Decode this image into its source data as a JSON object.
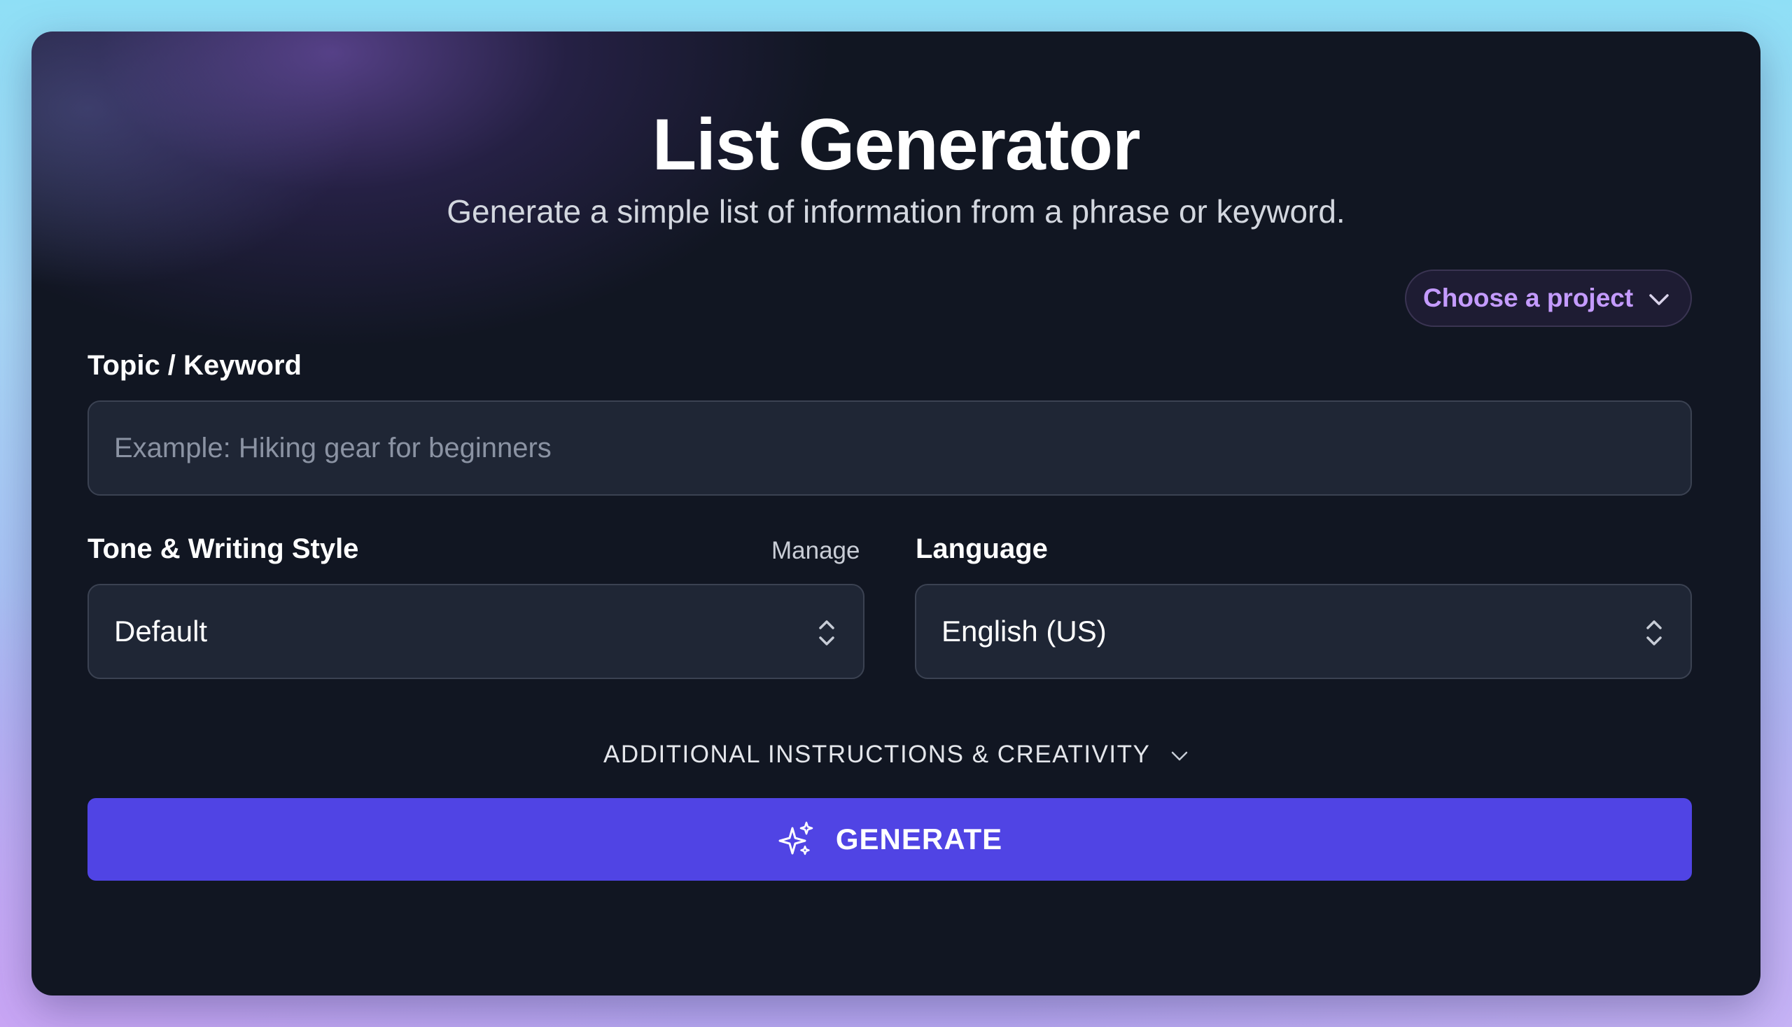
{
  "header": {
    "title": "List Generator",
    "subtitle": "Generate a simple list of information from a phrase or keyword."
  },
  "project_selector": {
    "label": "Choose a project",
    "icon": "chevron-down-icon"
  },
  "topic": {
    "label": "Topic / Keyword",
    "value": "",
    "placeholder": "Example: Hiking gear for beginners"
  },
  "tone": {
    "label": "Tone & Writing Style",
    "manage_label": "Manage",
    "selected": "Default",
    "icon": "chevron-up-down-icon"
  },
  "language": {
    "label": "Language",
    "selected": "English (US)",
    "icon": "chevron-up-down-icon"
  },
  "additional": {
    "label": "ADDITIONAL INSTRUCTIONS & CREATIVITY",
    "icon": "chevron-down-icon"
  },
  "generate": {
    "label": "GENERATE",
    "icon": "sparkles-icon"
  },
  "colors": {
    "accent": "#5044e4",
    "project_text": "#c49bff",
    "card_bg": "#111622",
    "field_bg": "#1f2635"
  }
}
